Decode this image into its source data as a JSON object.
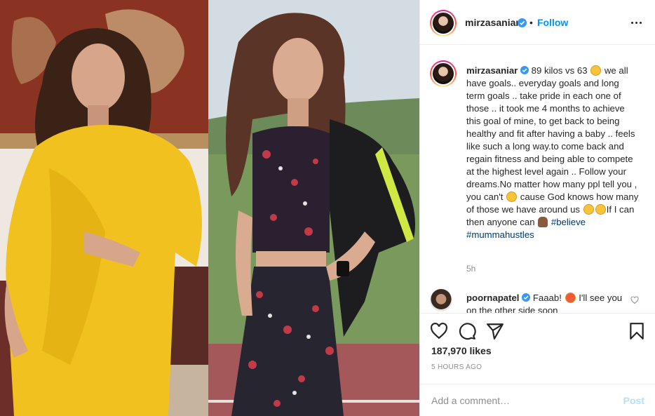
{
  "post": {
    "username": "mirzasaniar",
    "follow_label": "Follow",
    "separator": "•",
    "caption": {
      "username": "mirzasaniar",
      "lines": [
        "89 kilos vs 63",
        "we all have goals.. everyday goals and long term goals .. take pride in each one of those .. it took me 4 months to achieve this goal of mine, to get back to being healthy and fit after having a baby .. feels like such a long way.to come back and regain fitness and being able to compete at the highest level again .. Follow your dreams.No matter how many ppl tell you , you can't",
        "cause God knows how many of those we have around us",
        "If I can then anyone can"
      ],
      "hashtags": [
        "#believe",
        "#mummahustles"
      ],
      "time": "5h"
    },
    "comment": {
      "username": "poornapatel",
      "text": "Faaab!",
      "text2": "I'll see you on the other side soon"
    },
    "likes": "187,970 likes",
    "posted": "5 HOURS AGO",
    "add_comment_placeholder": "Add a comment…",
    "post_label": "Post",
    "icons": {
      "more": "more-options-icon",
      "verified": "verified-badge-icon",
      "like": "heart-icon",
      "comment": "comment-icon",
      "share": "share-icon",
      "save": "bookmark-icon"
    },
    "colors": {
      "accent": "#0095f6",
      "hashtag": "#00376b",
      "muted": "#8e8e8e",
      "post_disabled": "#b2dffc"
    }
  }
}
